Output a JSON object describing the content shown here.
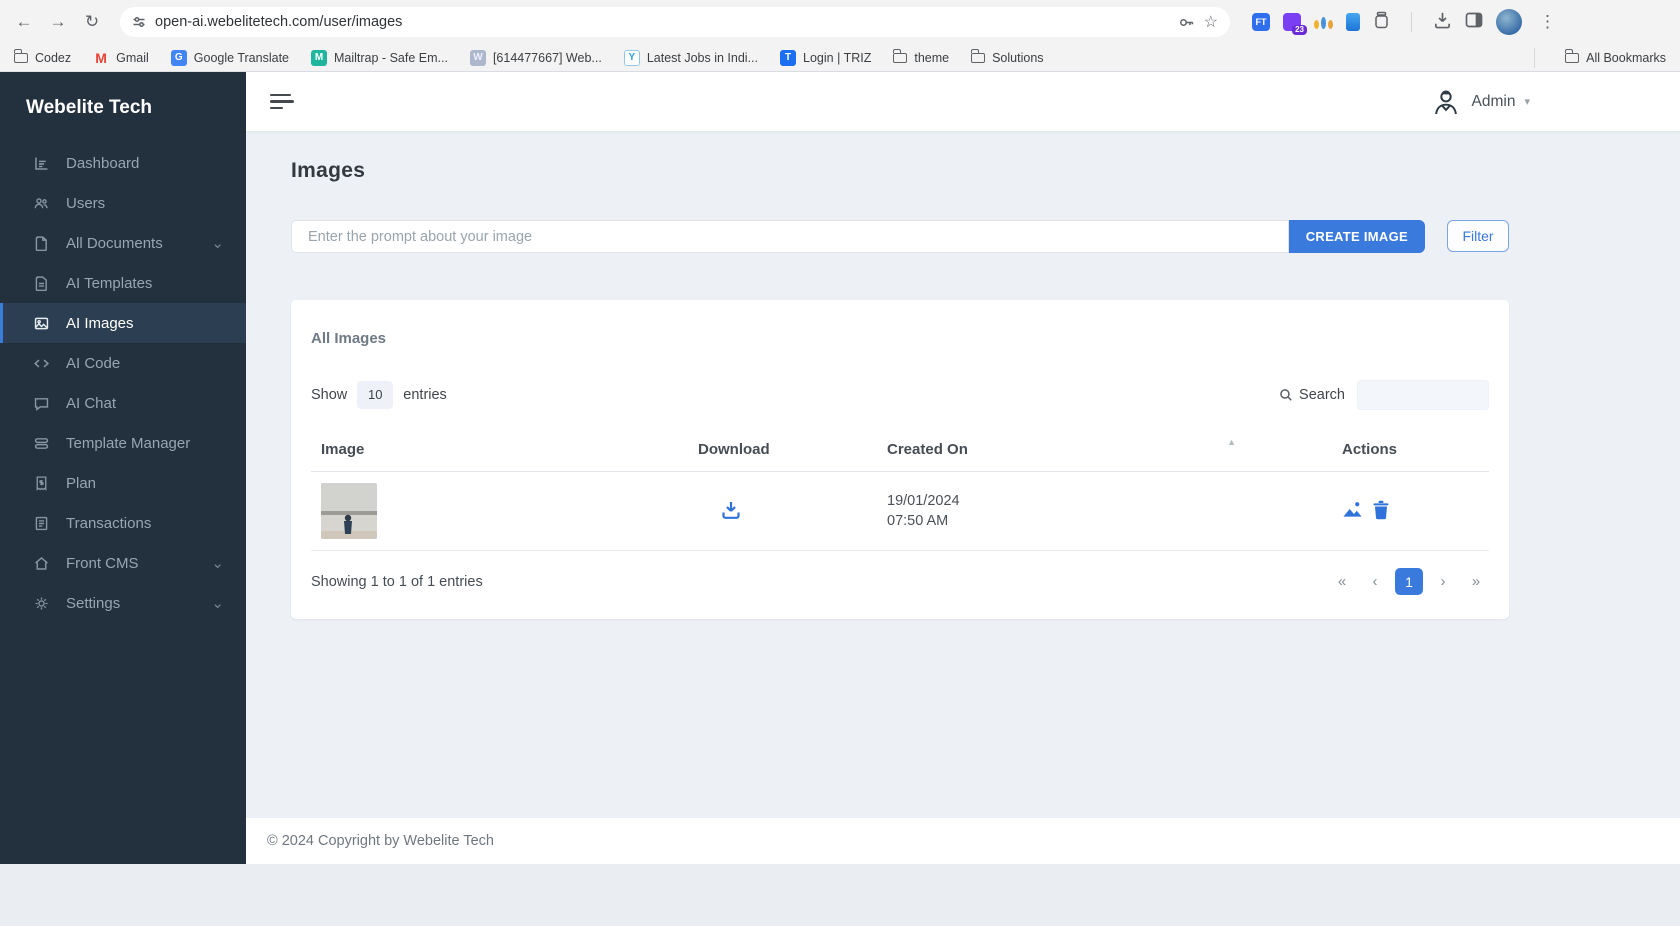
{
  "browser": {
    "url": "open-ai.webelitetech.com/user/images",
    "bookmarks": [
      "Codez",
      "Gmail",
      "Google Translate",
      "Mailtrap - Safe Em...",
      "[614477667] Web...",
      "Latest Jobs in Indi...",
      "Login | TRIZ",
      "theme",
      "Solutions"
    ],
    "all_bookmarks": "All Bookmarks",
    "extension_badge": "23"
  },
  "sidebar": {
    "brand": "Webelite Tech",
    "items": [
      {
        "label": "Dashboard"
      },
      {
        "label": "Users"
      },
      {
        "label": "All Documents"
      },
      {
        "label": "AI Templates"
      },
      {
        "label": "AI Images"
      },
      {
        "label": "AI Code"
      },
      {
        "label": "AI Chat"
      },
      {
        "label": "Template Manager"
      },
      {
        "label": "Plan"
      },
      {
        "label": "Transactions"
      },
      {
        "label": "Front CMS"
      },
      {
        "label": "Settings"
      }
    ]
  },
  "header": {
    "user_label": "Admin"
  },
  "page": {
    "title": "Images",
    "prompt_placeholder": "Enter the prompt about your image",
    "create_button_label": "CREATE IMAGE",
    "filter_button_label": "Filter"
  },
  "table_card": {
    "title": "All Images",
    "show_label": "Show",
    "entries_per_page": "10",
    "entries_label": "entries",
    "search_label": "Search",
    "columns": [
      "Image",
      "Download",
      "Created On",
      "Actions"
    ],
    "rows": [
      {
        "created_date": "19/01/2024",
        "created_time": "07:50 AM"
      }
    ],
    "summary": "Showing 1 to 1 of 1 entries",
    "pagination": {
      "first": "«",
      "prev": "‹",
      "current_page": "1",
      "next": "›",
      "last": "»"
    }
  },
  "footer": {
    "copyright": "© 2024 Copyright by Webelite Tech"
  },
  "colors": {
    "accent": "#3b7ddd",
    "sidebar_bg": "#23303e",
    "content_bg": "#edf1f6"
  }
}
